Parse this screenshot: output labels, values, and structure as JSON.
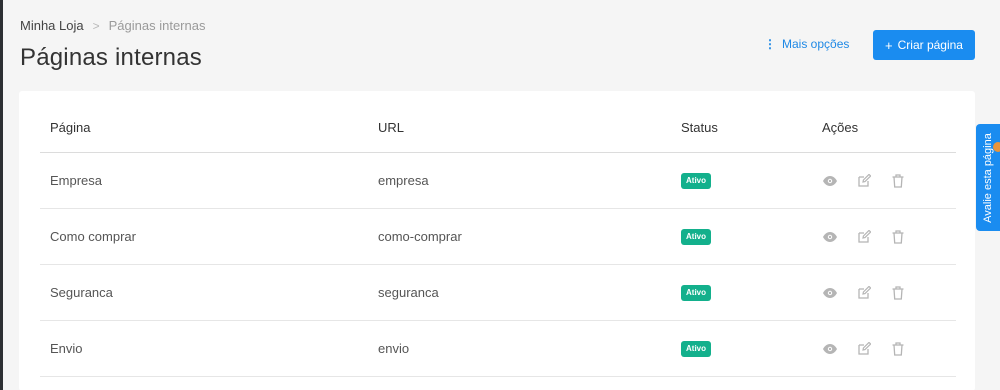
{
  "breadcrumb": {
    "root": "Minha Loja",
    "separator": ">",
    "current": "Páginas internas"
  },
  "header": {
    "title": "Páginas internas",
    "more_options": "Mais opções",
    "more_options_icon": "vertical-dots-icon",
    "create_button": "Criar página",
    "create_icon": "plus-icon"
  },
  "table": {
    "columns": [
      "Página",
      "URL",
      "Status",
      "Ações"
    ],
    "rows": [
      {
        "page": "Empresa",
        "url": "empresa",
        "status": "Ativo"
      },
      {
        "page": "Como comprar",
        "url": "como-comprar",
        "status": "Ativo"
      },
      {
        "page": "Seguranca",
        "url": "seguranca",
        "status": "Ativo"
      },
      {
        "page": "Envio",
        "url": "envio",
        "status": "Ativo"
      }
    ],
    "action_icons": [
      "eye-icon",
      "edit-icon",
      "trash-icon"
    ]
  },
  "feedback_tab": {
    "label": "Avalie esta página"
  },
  "colors": {
    "primary": "#1a8cf0",
    "status_active": "#13b08c",
    "text": "#333333",
    "muted": "#9a9a9a"
  }
}
